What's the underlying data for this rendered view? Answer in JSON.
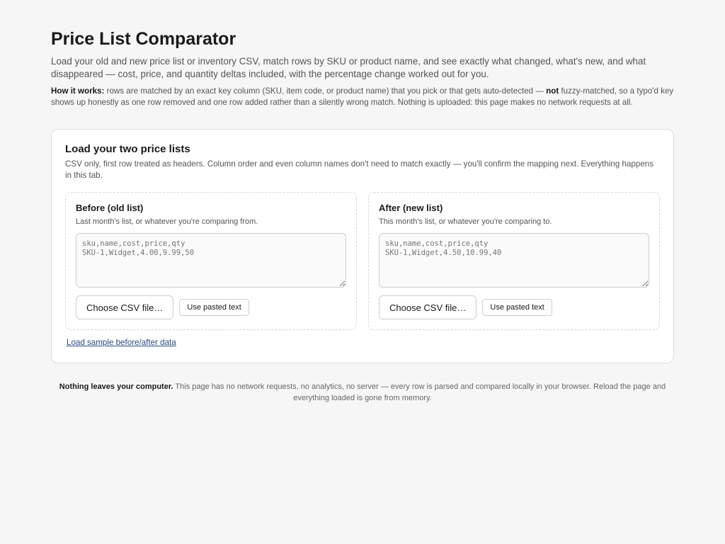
{
  "header": {
    "title": "Price List Comparator",
    "lede": "Load your old and new price list or inventory CSV, match rows by SKU or product name, and see exactly what changed, what's new, and what disappeared — cost, price, and quantity deltas included, with the percentage change worked out for you.",
    "how_label": "How it works:",
    "how_text_before": " rows are matched by an exact key column (SKU, item code, or product name) that you pick or that gets auto-detected — ",
    "how_emphasis": "not",
    "how_text_after": " fuzzy-matched, so a typo'd key shows up honestly as one row removed and one row added rather than a silently wrong match. Nothing is uploaded: this page makes no network requests at all."
  },
  "loader": {
    "title": "Load your two price lists",
    "subtitle": "CSV only, first row treated as headers. Column order and even column names don't need to match exactly — you'll confirm the mapping next. Everything happens in this tab.",
    "before": {
      "title": "Before (old list)",
      "hint": "Last month's list, or whatever you're comparing from.",
      "placeholder": "sku,name,cost,price,qty\nSKU-1,Widget,4.00,9.99,50",
      "choose_label": "Choose CSV file…",
      "paste_label": "Use pasted text"
    },
    "after": {
      "title": "After (new list)",
      "hint": "This month's list, or whatever you're comparing to.",
      "placeholder": "sku,name,cost,price,qty\nSKU-1,Widget,4.50,10.99,40",
      "choose_label": "Choose CSV file…",
      "paste_label": "Use pasted text"
    },
    "sample_link": "Load sample before/after data"
  },
  "footer": {
    "bold": "Nothing leaves your computer.",
    "text": " This page has no network requests, no analytics, no server — every row is parsed and compared locally in your browser. Reload the page and everything loaded is gone from memory."
  }
}
